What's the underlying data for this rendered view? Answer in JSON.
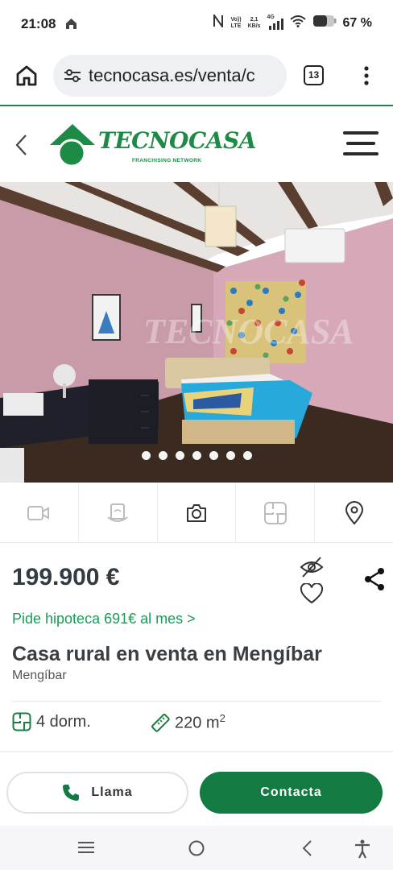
{
  "status_bar": {
    "time": "21:08",
    "net_top": "Vo))",
    "net_bottom": "LTE",
    "speed_top": "2,1",
    "speed_bottom": "KB/s",
    "signal_label": "4G",
    "battery": "67 %"
  },
  "browser": {
    "url": "tecnocasa.es/venta/c",
    "tab_count": "13"
  },
  "header": {
    "logo_text": "TECNOCASA",
    "logo_subtitle": "FRANCHISING NETWORK"
  },
  "photo": {
    "watermark": "TECNOCASA",
    "carousel_count": 7
  },
  "listing": {
    "price": "199.900 €",
    "mortgage_link": "Pide hipoteca 691€ al mes >",
    "title": "Casa rural en venta en Mengíbar",
    "location": "Mengíbar",
    "bedrooms": "4 dorm.",
    "area_value": "220 m",
    "area_unit_exp": "2"
  },
  "actions": {
    "call_label": "Llama",
    "contact_label": "Contacta"
  },
  "colors": {
    "brand_green": "#1d8a45",
    "button_green": "#137a42",
    "link_green": "#1a9b5a"
  }
}
